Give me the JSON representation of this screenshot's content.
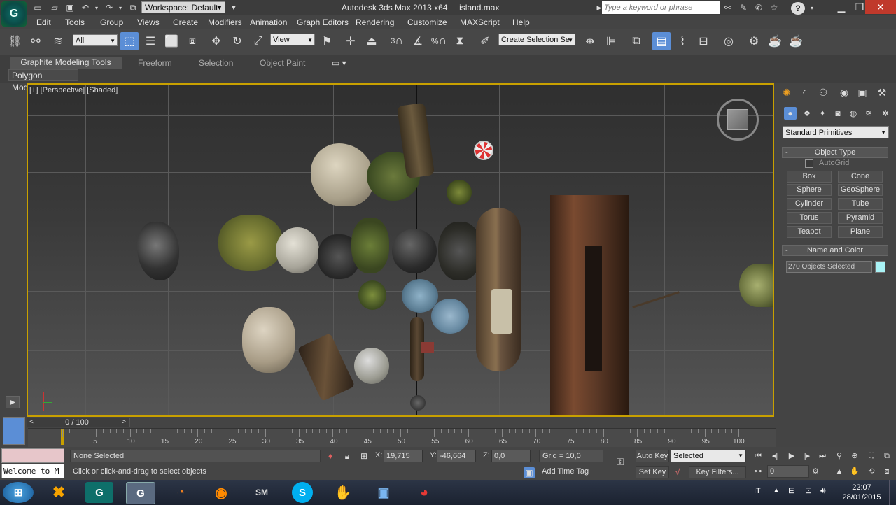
{
  "window": {
    "app_title": "Autodesk 3ds Max  2013 x64",
    "file_name": "island.max",
    "workspace": "Workspace: Default",
    "search_placeholder": "Type a keyword or phrase"
  },
  "menu": [
    "Edit",
    "Tools",
    "Group",
    "Views",
    "Create",
    "Modifiers",
    "Animation",
    "Graph Editors",
    "Rendering",
    "Customize",
    "MAXScript",
    "Help"
  ],
  "toolbar": {
    "selection_filter": "All",
    "ref_coord": "View",
    "named_selection_placeholder": "Create Selection Se",
    "snap_number": "3",
    "angle_snap_number": "%",
    "icons": [
      "link-icon",
      "unlink-icon",
      "bind-spacewarp-icon",
      "select-object-icon",
      "select-by-name-icon",
      "rect-region-icon",
      "window-crossing-icon",
      "move-icon",
      "rotate-icon",
      "scale-icon",
      "pivot-icon",
      "select-manipulate-icon",
      "keyboard-shortcut-icon",
      "snaps-toggle-icon",
      "angle-snap-icon",
      "percent-snap-icon",
      "spinner-snap-icon",
      "edit-named-selection-icon",
      "mirror-icon",
      "align-icon",
      "layer-manager-icon",
      "graphite-toggle-icon",
      "curve-editor-icon",
      "schematic-view-icon",
      "material-editor-icon",
      "render-setup-icon",
      "rendered-frame-icon",
      "render-production-icon"
    ]
  },
  "ribbon": {
    "tabs": [
      "Graphite Modeling Tools",
      "Freeform",
      "Selection",
      "Object Paint"
    ],
    "active_tab": "Graphite Modeling Tools",
    "panel_label": "Polygon Modeling"
  },
  "viewport": {
    "label": "[+] [Perspective] [Shaded]"
  },
  "command_panel": {
    "category": "Standard Primitives",
    "object_type_title": "Object Type",
    "autogrid_label": "AutoGrid",
    "primitives": [
      "Box",
      "Cone",
      "Sphere",
      "GeoSphere",
      "Cylinder",
      "Tube",
      "Torus",
      "Pyramid",
      "Teapot",
      "Plane"
    ],
    "name_color_title": "Name and Color",
    "object_name": "270 Objects Selected",
    "object_color": "#a9f3f6"
  },
  "timeline": {
    "frame_label": "0 / 100",
    "ticks": [
      "5",
      "10",
      "15",
      "20",
      "25",
      "30",
      "35",
      "40",
      "45",
      "50",
      "55",
      "60",
      "65",
      "70",
      "75",
      "80",
      "85",
      "90",
      "95",
      "100"
    ]
  },
  "status": {
    "selection": "None Selected",
    "prompt": "Click or click-and-drag to select objects",
    "welcome": "Welcome to M",
    "x_label": "X:",
    "x_value": "19,715",
    "y_label": "Y:",
    "y_value": "-46,664",
    "z_label": "Z:",
    "z_value": "0,0",
    "grid": "Grid = 10,0",
    "add_time_tag": "Add Time Tag",
    "auto_key": "Auto Key",
    "set_key": "Set Key",
    "key_mode": "Selected",
    "key_filters": "Key Filters...",
    "current_frame": "0"
  },
  "taskbar": {
    "lang": "IT",
    "time": "22:07",
    "date": "28/01/2015",
    "apps": [
      "start-orb",
      "xampp",
      "3dsmax-2013",
      "3dsmax",
      "blender",
      "firefox",
      "sm-app",
      "skype",
      "gimp",
      "photo-viewer",
      "chrome"
    ]
  }
}
